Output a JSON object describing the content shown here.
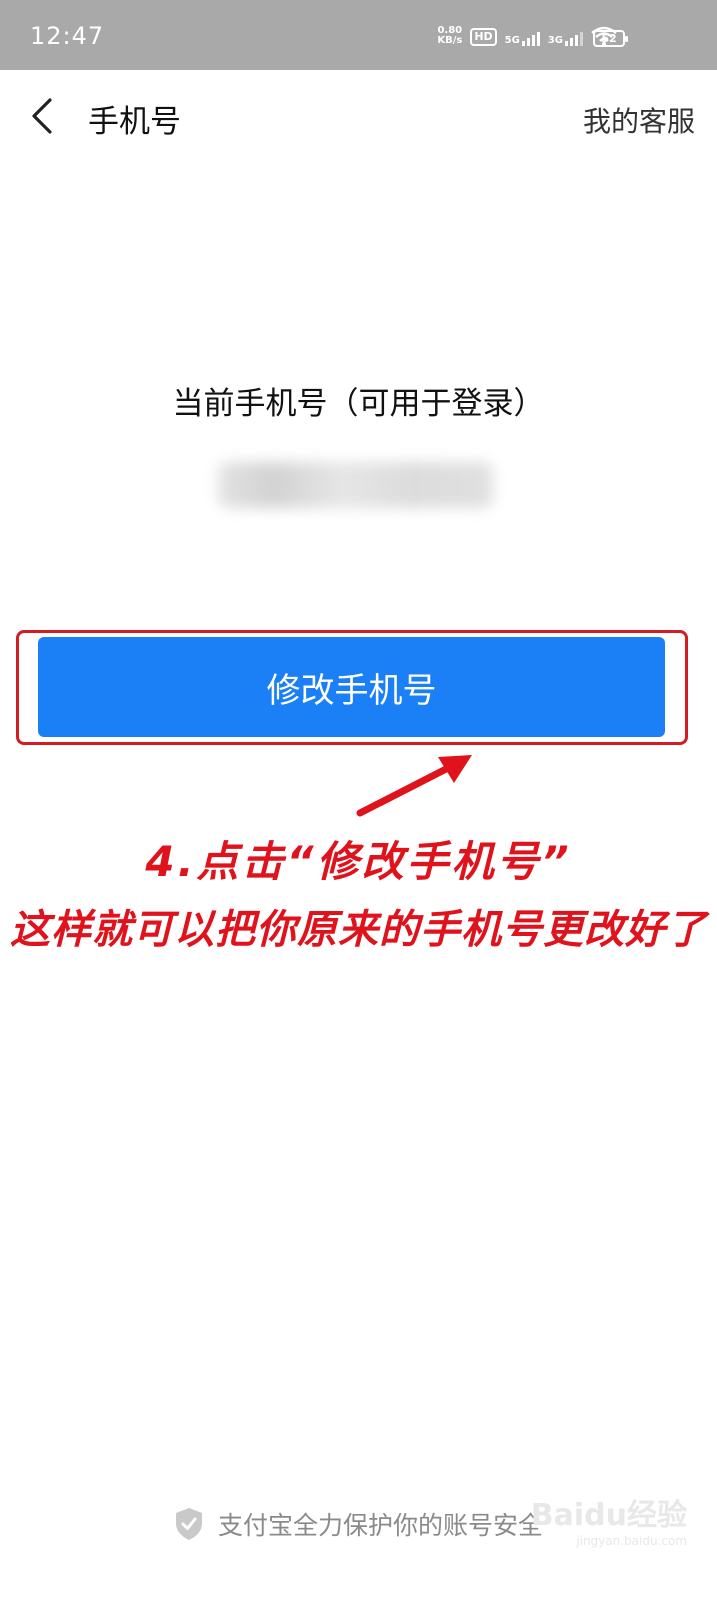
{
  "status_bar": {
    "time": "12:47",
    "speed_value": "0.80",
    "speed_unit": "KB/s",
    "hd_label": "HD",
    "net1": "5G",
    "net2": "3G",
    "battery": "52"
  },
  "header": {
    "back_icon": "chevron-left-icon",
    "title": "手机号",
    "service_label": "我的客服"
  },
  "main": {
    "current_phone_label": "当前手机号（可用于登录）",
    "modify_button_label": "修改手机号"
  },
  "annotation": {
    "line1": "4.点击“修改手机号”",
    "line2": "这样就可以把你原来的手机号更改好了",
    "color": "#e0121c"
  },
  "footer": {
    "icon": "shield-check-icon",
    "text": "支付宝全力保护你的账号安全"
  },
  "watermark": {
    "brand": "Baidu经验",
    "url": "jingyan.baidu.com"
  },
  "colors": {
    "primary": "#1b7ff5",
    "highlight_border": "#d61c23",
    "status_bar": "#a9a9a9"
  }
}
